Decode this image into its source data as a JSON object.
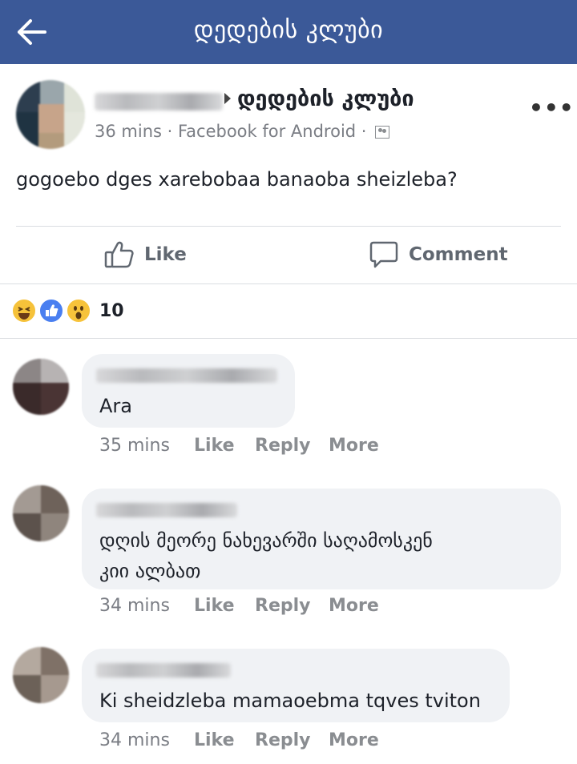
{
  "header": {
    "title": "დედების კლუბი",
    "back_icon": "arrow-left-icon"
  },
  "post": {
    "group_name": "დედების კლუბი",
    "time": "36 mins",
    "source": "Facebook for Android",
    "separator": "·",
    "audience_icon": "friends-icon",
    "more_icon": "more-dots-icon",
    "more_label": "•••",
    "text": "gogoebo dges xarebobaa banaoba sheizleba?"
  },
  "actions": {
    "like_label": "Like",
    "comment_label": "Comment"
  },
  "reactions": {
    "count": "10",
    "types": [
      "haha",
      "like",
      "wow"
    ]
  },
  "comments": [
    {
      "text": "Ara",
      "time": "35 mins",
      "like": "Like",
      "reply": "Reply",
      "more": "More"
    },
    {
      "text": "დღის მეორე ნახევარში საღამოსკენ კიი ალბათ",
      "line1": "დღის მეორე ნახევარში საღამოსკენ",
      "line2": "კიი ალბათ",
      "time": "34 mins",
      "like": "Like",
      "reply": "Reply",
      "more": "More"
    },
    {
      "text": "Ki sheidzleba mamaoebma tqves tviton",
      "time": "34 mins",
      "like": "Like",
      "reply": "Reply",
      "more": "More"
    }
  ],
  "colors": {
    "header_bg": "#3b5998",
    "bubble_bg": "#f0f2f5",
    "meta_text": "#7a7d84"
  }
}
